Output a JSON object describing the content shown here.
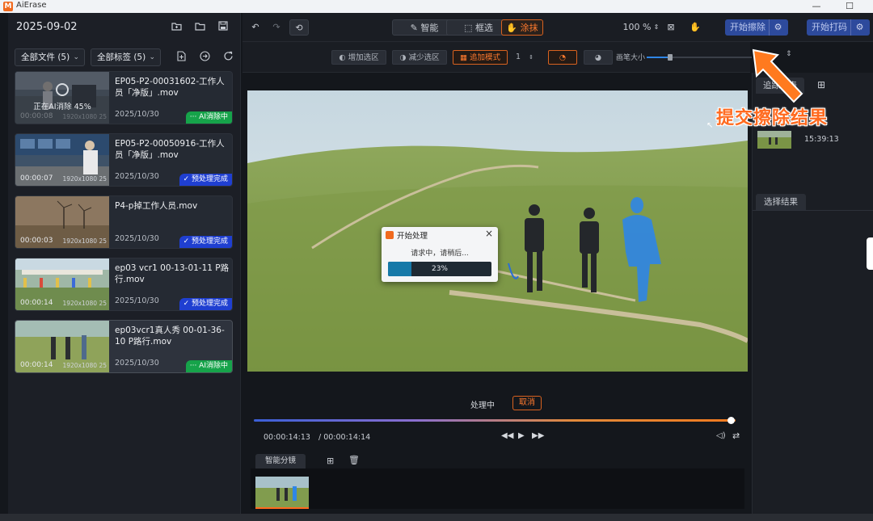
{
  "window": {
    "title": "AiErase",
    "minimize": "—",
    "maximize": "☐"
  },
  "left": {
    "date": "2025-09-02",
    "filter_files": "全部文件 (5)",
    "filter_tags": "全部标签 (5)",
    "files": [
      {
        "name": "EP05-P2-00031602-工作人员「净版」.mov",
        "date": "2025/10/30",
        "badge": "··· AI消除中",
        "badge_type": "green",
        "overlay_text": "正在AI消除 45%",
        "timecode": "00:00:08",
        "res": "1920x1080 25"
      },
      {
        "name": "EP05-P2-00050916-工作人员「净版」.mov",
        "date": "2025/10/30",
        "badge": "✓ 预处理完成",
        "badge_type": "blue",
        "timecode": "00:00:07",
        "res": "1920x1080 25"
      },
      {
        "name": "P4-p掉工作人员.mov",
        "date": "2025/10/30",
        "badge": "✓ 预处理完成",
        "badge_type": "blue",
        "timecode": "00:00:03",
        "res": "1920x1080 25"
      },
      {
        "name": "ep03 vcr1 00-13-01-11 P路行.mov",
        "date": "2025/10/30",
        "badge": "✓ 预处理完成",
        "badge_type": "blue",
        "timecode": "00:00:14",
        "res": "1920x1080 25"
      },
      {
        "name": "ep03vcr1真人秀 00-01-36-10 P路行.mov",
        "date": "2025/10/30",
        "badge": "··· AI消除中",
        "badge_type": "green",
        "timecode": "00:00:14",
        "res": "1920x1080 25"
      }
    ]
  },
  "toolbar": {
    "smart": "智能",
    "box_select": "框选",
    "paint": "涂抹",
    "zoom": "100 %",
    "start_erase": "开始擦除",
    "start_mosaic": "开始打码"
  },
  "subtoolbar": {
    "add_selection": "增加选区",
    "reduce_selection": "减少选区",
    "append_mode": "追加模式",
    "count": "1",
    "brush_size": "画笔大小"
  },
  "dialog": {
    "title": "开始处理",
    "message": "请求中，请稍后...",
    "progress_text": "23%",
    "progress": 0.23
  },
  "playback": {
    "status": "处理中",
    "cancel": "取消",
    "current_time": "00:00:14:13",
    "total_time": "/ 00:00:14:14",
    "progress": 0.99
  },
  "storyboard": {
    "tab": "智能分镜"
  },
  "right": {
    "tab_list": "追踪列表",
    "tab_results": "选择结果",
    "item_time": "15:39:13"
  },
  "annotation": {
    "text": "提交擦除结果"
  },
  "colors": {
    "accent_orange": "#ff6a1f",
    "ai_green": "#16a34a",
    "done_blue": "#1f3fd1",
    "mask_blue": "#2f86e6"
  }
}
